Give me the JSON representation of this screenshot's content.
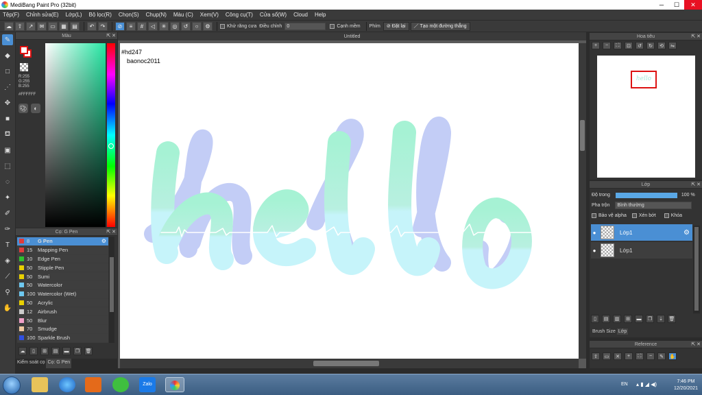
{
  "window": {
    "title": "MediBang Paint Pro (32bit)"
  },
  "menu": [
    "Tệp(F)",
    "Chỉnh sửa(E)",
    "Lớp(L)",
    "Bộ lọc(R)",
    "Chọn(S)",
    "Chụp(N)",
    "Màu (C)",
    "Xem(V)",
    "Công cụ(T)",
    "Cửa sổ(W)",
    "Cloud",
    "Help"
  ],
  "toolbar": {
    "antialias_label": "Khử răng cưa",
    "adjust_label": "Điều chỉnh",
    "adjust_value": "0",
    "edge_label": "Cạnh mềm",
    "keys_label": "Phím",
    "reset_label": "Đặt lại",
    "line_label": "Tạo một đường thẳng"
  },
  "color_panel": {
    "title": "Màu",
    "r": "R:255",
    "g": "G:255",
    "b": "B:255",
    "hex": "#FFFFFF"
  },
  "brush_panel": {
    "title": "Cọ: G Pen",
    "brushes": [
      {
        "size": "8",
        "name": "G Pen",
        "color": "#e03c3c"
      },
      {
        "size": "15",
        "name": "Mapping Pen",
        "color": "#e03c3c"
      },
      {
        "size": "10",
        "name": "Edge Pen",
        "color": "#2ec02e"
      },
      {
        "size": "50",
        "name": "Stipple Pen",
        "color": "#e8d000"
      },
      {
        "size": "50",
        "name": "Sumi",
        "color": "#e8d000"
      },
      {
        "size": "50",
        "name": "Watercolor",
        "color": "#6ec8f0"
      },
      {
        "size": "100",
        "name": "Watercolor (Wet)",
        "color": "#6ec8f0"
      },
      {
        "size": "50",
        "name": "Acrylic",
        "color": "#e8d000"
      },
      {
        "size": "12",
        "name": "Airbrush",
        "color": "#cccccc"
      },
      {
        "size": "50",
        "name": "Blur",
        "color": "#f0a0c8"
      },
      {
        "size": "70",
        "name": "Smudge",
        "color": "#f0c8a0"
      },
      {
        "size": "100",
        "name": "Sparkle Brush",
        "color": "#3050e0"
      }
    ]
  },
  "left_tabs": [
    "Kiểm soát cọ",
    "Cọ: G Pen"
  ],
  "document": {
    "tab": "Untitled",
    "text1": "#hd247",
    "text2": "baonoc2011",
    "art_word": "hello"
  },
  "navigator": {
    "title": "Hoa tiêu"
  },
  "layer_panel": {
    "title": "Lớp",
    "opacity_label": "Độ trong",
    "opacity_value": "100 %",
    "opacity_fraction": 1.0,
    "blend_label": "Pha trộn",
    "blend_value": "Bình thường",
    "protect_alpha": "Bảo vệ alpha",
    "clipping": "Xén bớt",
    "lock": "Khóa",
    "layers": [
      {
        "name": "Lớp1",
        "selected": true
      },
      {
        "name": "Lớp1",
        "selected": false
      }
    ],
    "tabs": [
      "Brush Size",
      "Lớp"
    ]
  },
  "reference_panel": {
    "title": "Reference"
  },
  "taskbar": {
    "lang": "EN",
    "time": "7:46 PM",
    "date": "12/20/2021",
    "zalo": "Zalo"
  },
  "colors": {
    "accent": "#4a8fd4",
    "mint": "#a8f0d0",
    "cyan": "#c4f4f8",
    "lavender": "#c0ccf8"
  }
}
